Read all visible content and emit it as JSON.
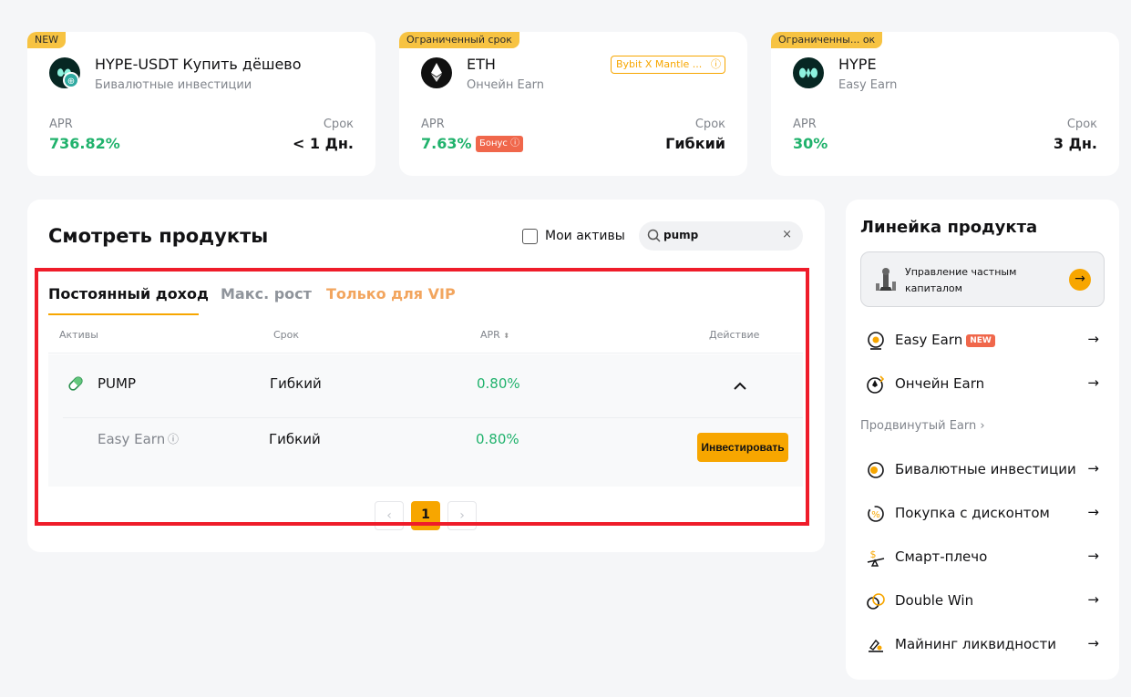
{
  "promos": [
    {
      "badge": "NEW",
      "name": "HYPE-USDT Купить дёшево",
      "sub": "Бивалютные инвестиции",
      "apr_label": "APR",
      "apr": "736.82%",
      "term_label": "Срок",
      "term": "< 1 Дн."
    },
    {
      "badge": "Ограниченный срок",
      "name": "ETH",
      "sub": "Ончейн Earn",
      "tag": "Bybit X Mantle ...",
      "apr_label": "APR",
      "apr": "7.63%",
      "bonus": "Бонус",
      "term_label": "Срок",
      "term": "Гибкий"
    },
    {
      "badge": "Ограниченны... ок",
      "name": "HYPE",
      "sub": "Easy Earn",
      "apr_label": "APR",
      "apr": "30%",
      "term_label": "Срок",
      "term": "3 Дн."
    }
  ],
  "main": {
    "title": "Смотреть продукты",
    "my_assets_label": "Мои активы",
    "search_value": "pump",
    "tabs": [
      "Постоянный доход",
      "Макс. рост",
      "Только для VIP"
    ],
    "columns": [
      "Активы",
      "Срок",
      "APR",
      "Действие"
    ],
    "row": {
      "asset": "PUMP",
      "term": "Гибкий",
      "apr": "0.80%"
    },
    "subrow": {
      "product": "Easy Earn",
      "term": "Гибкий",
      "apr": "0.80%",
      "action": "Инвестировать"
    },
    "page": "1"
  },
  "side": {
    "title": "Линейка продукта",
    "wealth": "Управление частным капиталом",
    "items": [
      {
        "label": "Easy Earn",
        "badge": "NEW"
      },
      {
        "label": "Ончейн Earn"
      }
    ],
    "advanced_label": "Продвинутый Earn",
    "advanced": [
      {
        "label": "Бивалютные инвестиции"
      },
      {
        "label": "Покупка с дисконтом"
      },
      {
        "label": "Смарт-плечо"
      },
      {
        "label": "Double Win"
      },
      {
        "label": "Майнинг ликвидности"
      }
    ]
  },
  "colors": {
    "accent": "#f7a600",
    "positive": "#20b26c",
    "highlight": "#ef1c2a"
  }
}
